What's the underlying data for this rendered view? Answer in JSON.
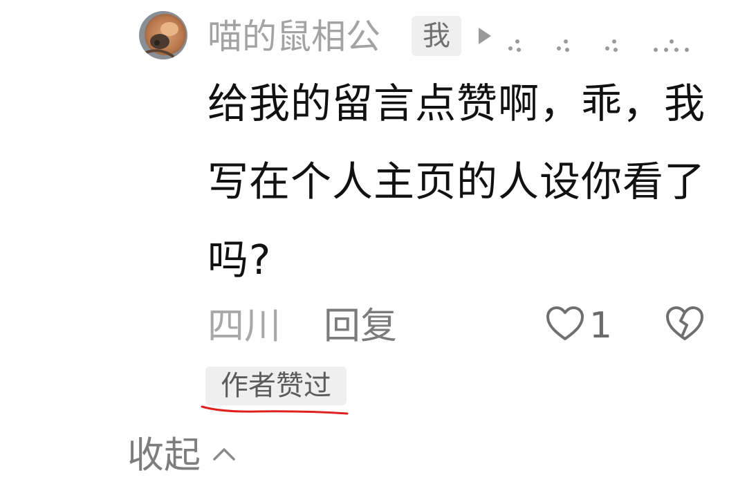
{
  "comment": {
    "avatar": {
      "icon": "cat-avatar-icon"
    },
    "username": "喵的鼠相公",
    "me_tag": "我",
    "text": "给我的留言点赞啊，乖，我写在个人主页的人设你看了吗?",
    "location": "四川",
    "reply_label": "回复",
    "likes": "1",
    "author_liked_badge": "作者赞过"
  },
  "footer": {
    "collapse_label": "收起"
  },
  "colors": {
    "text_primary": "#111111",
    "text_secondary": "#a3a3a3",
    "tag_background": "#efefef",
    "annotation_red": "#e01f1f"
  }
}
